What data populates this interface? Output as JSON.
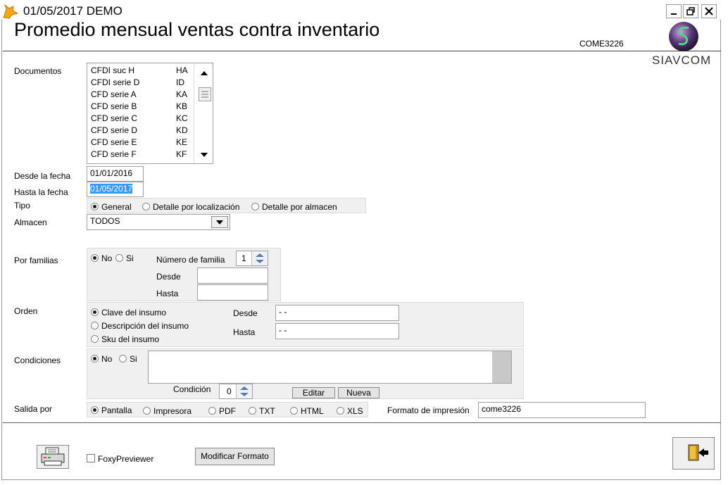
{
  "window": {
    "title": "01/05/2017  DEMO",
    "minimize_label": "_",
    "close_label": "✕"
  },
  "header": {
    "title": "Promedio mensual ventas contra inventario",
    "code": "COME3226",
    "logo_text": "SIAVCOM"
  },
  "labels": {
    "documentos": "Documentos",
    "desde_fecha": "Desde la fecha",
    "hasta_fecha": "Hasta la fecha",
    "tipo": "Tipo",
    "almacen": "Almacen",
    "por_familias": "Por familias",
    "orden": "Orden",
    "condiciones": "Condiciones",
    "salida_por": "Salida por",
    "formato_impresion": "Formato de impresión"
  },
  "documentos": [
    {
      "name": "CFDI  suc  H",
      "code": "HA"
    },
    {
      "name": "CFDI  serie D",
      "code": "ID"
    },
    {
      "name": "CFD serie A",
      "code": "KA"
    },
    {
      "name": "CFD serie B",
      "code": "KB"
    },
    {
      "name": "CFD serie C",
      "code": "KC"
    },
    {
      "name": "CFD serie D",
      "code": "KD"
    },
    {
      "name": "CFD serie E",
      "code": "KE"
    },
    {
      "name": "CFD serie F",
      "code": "KF"
    }
  ],
  "fechas": {
    "desde": "01/01/2016",
    "hasta": "01/05/2017"
  },
  "tipo": {
    "options": [
      "General",
      "Detalle por localización",
      "Detalle por almacen"
    ],
    "selected": "General"
  },
  "almacen": {
    "value": "TODOS"
  },
  "familias": {
    "no": "No",
    "si": "Si",
    "selected": "No",
    "numero_label": "Número de familia",
    "numero_value": "1",
    "desde_label": "Desde",
    "hasta_label": "Hasta",
    "desde_value": "",
    "hasta_value": ""
  },
  "orden": {
    "options": [
      "Clave del insumo",
      "Descripción del insumo",
      "Sku del insumo"
    ],
    "selected": "Clave del insumo",
    "desde_label": "Desde",
    "hasta_label": "Hasta",
    "desde_value": "-  -",
    "hasta_value": "-  -"
  },
  "condiciones": {
    "no": "No",
    "si": "Si",
    "selected": "No",
    "condicion_label": "Condición",
    "condicion_value": "0",
    "editar_label": "Editar",
    "nueva_label": "Nueva",
    "text": ""
  },
  "salida": {
    "options": [
      "Pantalla",
      "Impresora",
      "PDF",
      "TXT",
      "HTML",
      "XLS"
    ],
    "selected": "Pantalla",
    "formato_value": "come3226"
  },
  "footer": {
    "foxy_label": "FoxyPreviewer",
    "modificar_label": "Modificar Formato"
  },
  "colors": {
    "selection": "#3399ff",
    "panel": "#f0f0f0",
    "logo_purple": "#5a3a7a",
    "logo_green": "#3a8a5a"
  }
}
